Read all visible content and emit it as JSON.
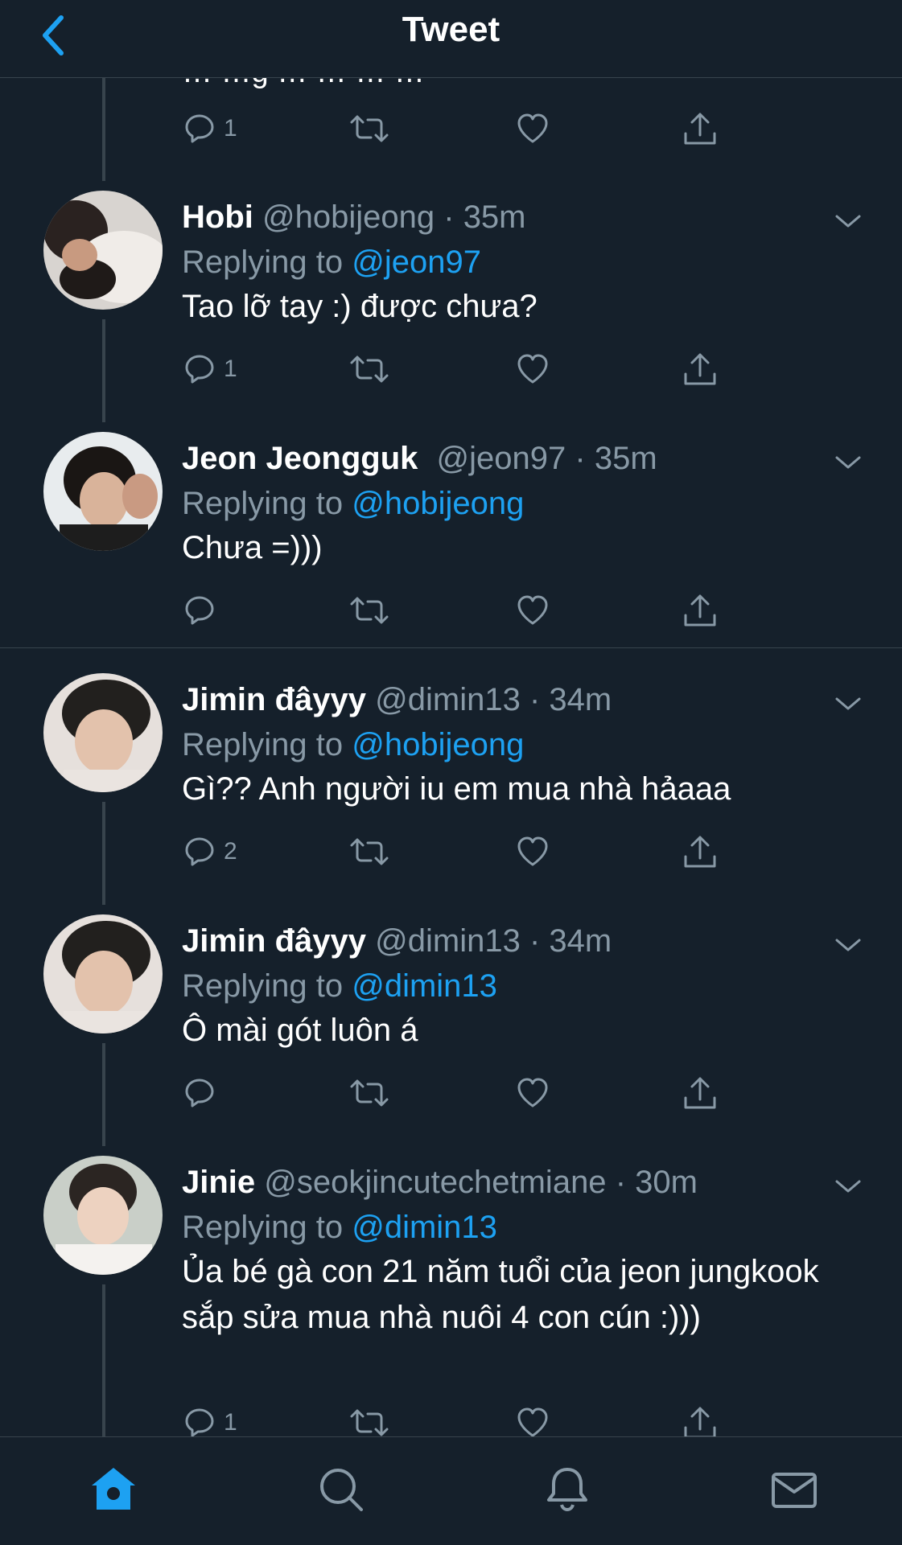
{
  "header": {
    "title": "Tweet"
  },
  "clipped_previous": {
    "text": "… …g … … … …",
    "reply_count": "1"
  },
  "tweets": [
    {
      "name": "Hobi",
      "handle": "@hobijeong",
      "sep": "·",
      "time": "35m",
      "replying_prefix": "Replying to ",
      "replying_to": "@jeon97",
      "text": "Tao lỡ tay :) được chưa?",
      "reply_count": "1"
    },
    {
      "name": "Jeon Jeongguk",
      "handle": "@jeon97",
      "sep": "·",
      "time": "35m",
      "replying_prefix": "Replying to ",
      "replying_to": "@hobijeong",
      "text": "Chưa =)))",
      "reply_count": ""
    },
    {
      "name": "Jimin đâyyy",
      "handle": "@dimin13",
      "sep": "·",
      "time": "34m",
      "replying_prefix": "Replying to ",
      "replying_to": "@hobijeong",
      "text": "Gì?? Anh người iu em mua nhà hảaaa",
      "reply_count": "2"
    },
    {
      "name": "Jimin đâyyy",
      "handle": "@dimin13",
      "sep": "·",
      "time": "34m",
      "replying_prefix": "Replying to ",
      "replying_to": "@dimin13",
      "text": "Ô mài gót luôn á",
      "reply_count": ""
    },
    {
      "name": "Jinie",
      "handle": "@seokjincutechetmiane",
      "sep": "·",
      "time": "30m",
      "replying_prefix": "Replying to ",
      "replying_to": "@dimin13",
      "text": "Ủa bé gà con 21 năm tuổi của jeon jungkook sắp sửa mua nhà nuôi 4 con cún :)))",
      "reply_count": "1"
    }
  ],
  "tabbar": {
    "active": "home",
    "items": [
      "home-icon",
      "search-icon",
      "bell-icon",
      "mail-icon"
    ]
  },
  "colors": {
    "background": "#15202b",
    "accent": "#1da1f2",
    "muted": "#8899a6",
    "divider": "#38444d"
  }
}
